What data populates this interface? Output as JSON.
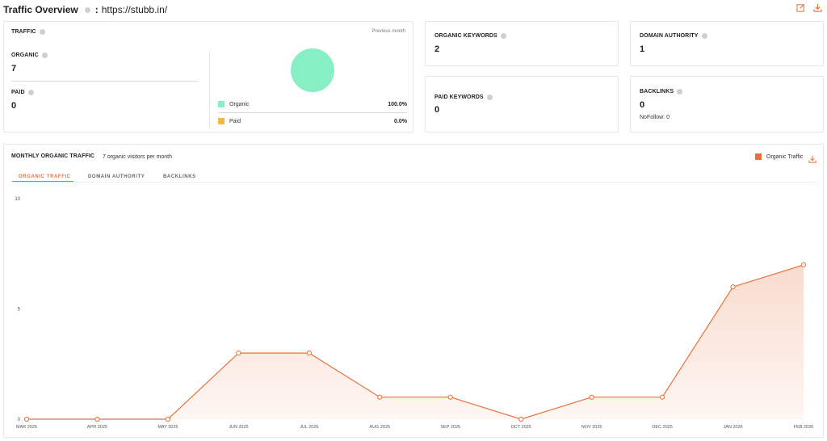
{
  "header": {
    "title": "Traffic Overview",
    "separator": ":",
    "url": "https://stubb.in/"
  },
  "traffic": {
    "label": "TRAFFIC",
    "period": "Previous month",
    "organic_label": "ORGANIC",
    "organic_value": "7",
    "paid_label": "PAID",
    "paid_value": "0",
    "legend": [
      {
        "name": "Organic",
        "pct": "100.0%",
        "color": "#86efc3"
      },
      {
        "name": "Paid",
        "pct": "0.0%",
        "color": "#f5b942"
      }
    ]
  },
  "organic_keywords": {
    "label": "ORGANIC KEYWORDS",
    "value": "2"
  },
  "domain_authority": {
    "label": "DOMAIN AUTHORITY",
    "value": "1"
  },
  "paid_keywords": {
    "label": "PAID KEYWORDS",
    "value": "0"
  },
  "backlinks": {
    "label": "BACKLINKS",
    "value": "0",
    "nofollow": "NoFollow: 0"
  },
  "monthly": {
    "title": "MONTHLY ORGANIC TRAFFIC",
    "subtitle": "7 organic visitors per month",
    "legend_label": "Organic Traffic",
    "accent": "#e8703a",
    "tabs": [
      {
        "label": "ORGANIC TRAFFIC",
        "active": true
      },
      {
        "label": "DOMAIN AUTHORITY",
        "active": false
      },
      {
        "label": "BACKLINKS",
        "active": false
      }
    ]
  },
  "chart_data": {
    "type": "area",
    "categories": [
      "MAR 2025",
      "APR 2025",
      "MAY 2025",
      "JUN 2025",
      "JUL 2025",
      "AUG 2025",
      "SEP 2025",
      "OCT 2025",
      "NOV 2025",
      "DEC 2025",
      "JAN 2026",
      "FEB 2026"
    ],
    "series": [
      {
        "name": "Organic Traffic",
        "values": [
          0,
          0,
          0,
          3,
          3,
          1,
          1,
          0,
          1,
          1,
          6,
          7
        ]
      }
    ],
    "yticks": [
      "0",
      "5",
      "10"
    ],
    "ylim": [
      0,
      10
    ],
    "legend": "top-right",
    "grid": false
  }
}
